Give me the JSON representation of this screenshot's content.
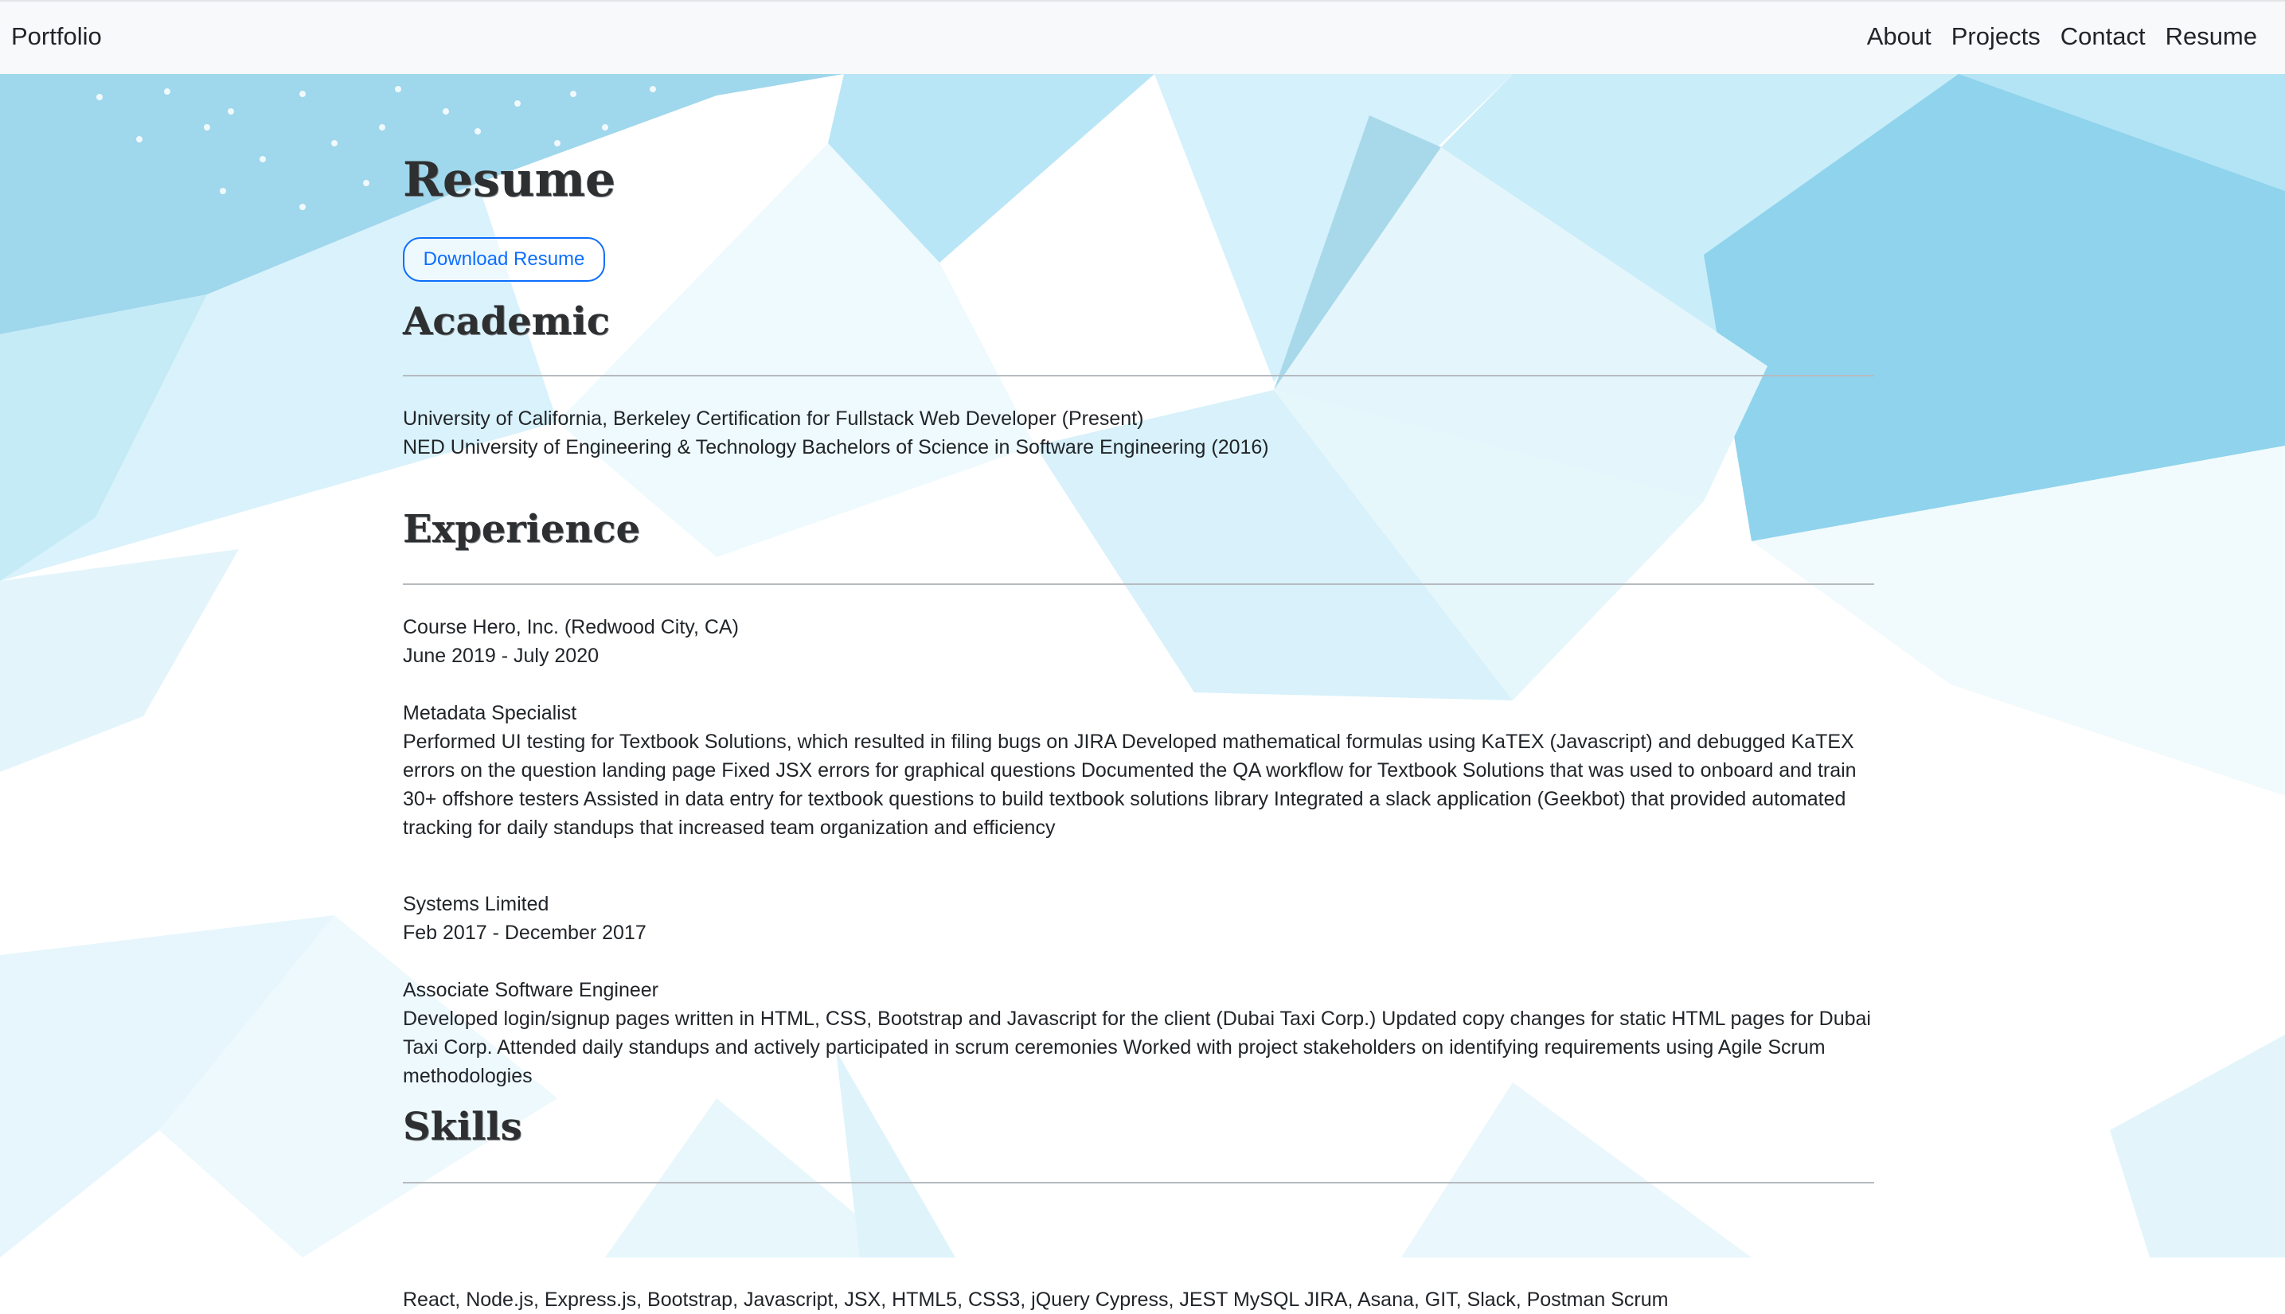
{
  "navbar": {
    "brand": "Portfolio",
    "links": [
      "About",
      "Projects",
      "Contact",
      "Resume"
    ]
  },
  "resume": {
    "title": "Resume",
    "download_label": "Download Resume"
  },
  "academic": {
    "title": "Academic",
    "items": [
      "University of California, Berkeley Certification for Fullstack Web Developer (Present)",
      "NED University of Engineering & Technology Bachelors of Science in Software Engineering (2016)"
    ]
  },
  "experience": {
    "title": "Experience",
    "jobs": [
      {
        "company": "Course Hero, Inc. (Redwood City, CA)",
        "dates": "June 2019 - July 2020",
        "role": "Metadata Specialist",
        "description": "Performed UI testing for Textbook Solutions, which resulted in filing bugs on JIRA Developed mathematical formulas using KaTEX (Javascript) and debugged KaTEX errors on the question landing page Fixed JSX errors for graphical questions Documented the QA workflow for Textbook Solutions that was used to onboard and train 30+ offshore testers Assisted in data entry for textbook questions to build textbook solutions library Integrated a slack application (Geekbot) that provided automated tracking for daily standups that increased team organization and efficiency"
      },
      {
        "company": "Systems Limited",
        "dates": "Feb 2017 - December 2017",
        "role": "Associate Software Engineer",
        "description": "Developed login/signup pages written in HTML, CSS, Bootstrap and Javascript for the client (Dubai Taxi Corp.) Updated copy changes for static HTML pages for Dubai Taxi Corp. Attended daily standups and actively participated in scrum ceremonies Worked with project stakeholders on identifying requirements using Agile Scrum methodologies"
      }
    ]
  },
  "skills": {
    "title": "Skills",
    "list": "React, Node.js, Express.js, Bootstrap, Javascript, JSX, HTML5, CSS3, jQuery Cypress, JEST MySQL JIRA, Asana, GIT, Slack, Postman Scrum"
  },
  "colors": {
    "accent": "#0d6efd",
    "background_tint": "#aee3f5",
    "navbar_bg": "#f8f9fa"
  }
}
